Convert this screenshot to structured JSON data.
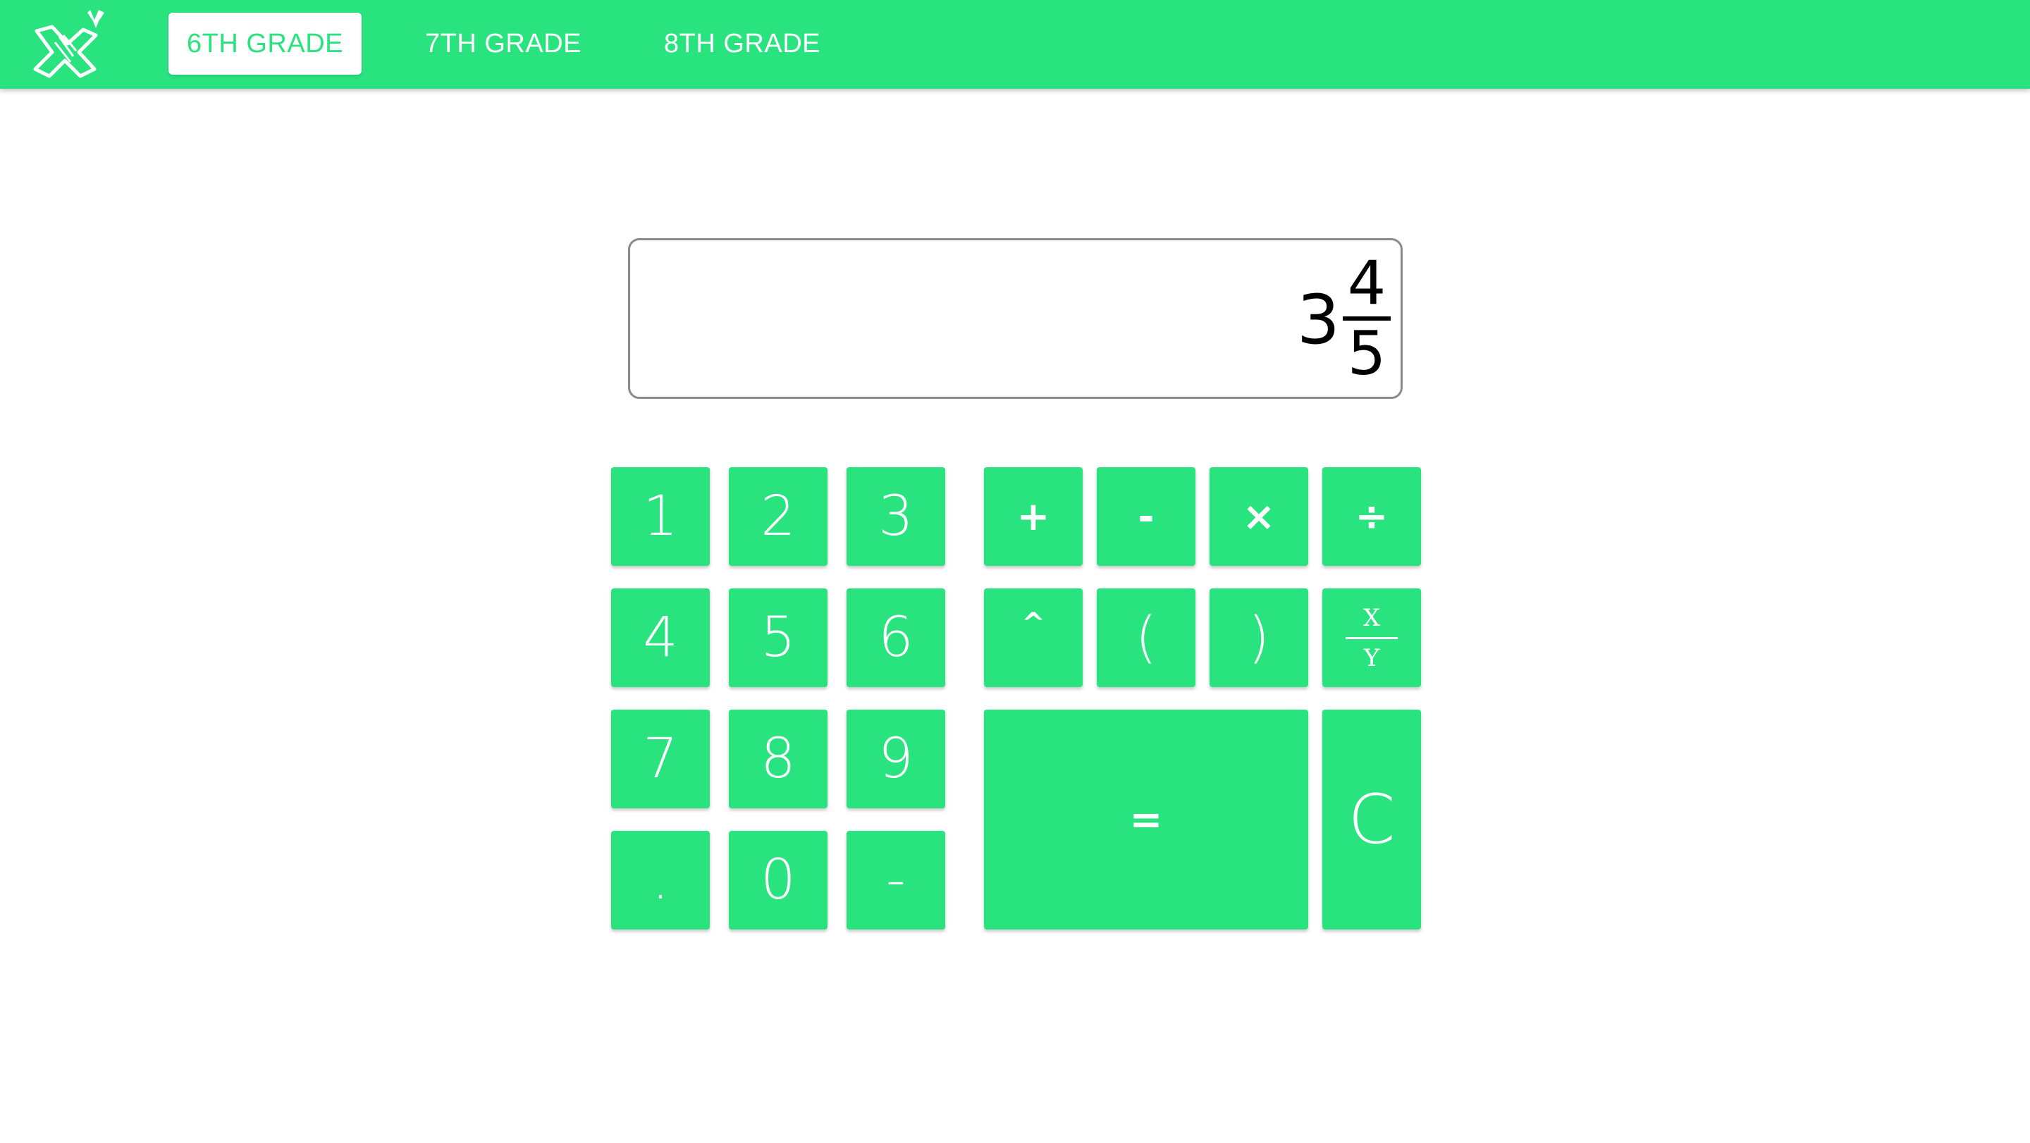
{
  "nav": {
    "logo": "math-x-logo",
    "tabs": [
      {
        "label": "6TH GRADE",
        "active": true
      },
      {
        "label": "7TH GRADE",
        "active": false
      },
      {
        "label": "8TH GRADE",
        "active": false
      }
    ]
  },
  "display": {
    "whole": "3",
    "numerator": "4",
    "denominator": "5"
  },
  "keypad": {
    "k1": "1",
    "k2": "2",
    "k3": "3",
    "k4": "4",
    "k5": "5",
    "k6": "6",
    "k7": "7",
    "k8": "8",
    "k9": "9",
    "dot": ".",
    "k0": "0",
    "neg": "-",
    "plus": "+",
    "minus": "-",
    "times": "×",
    "divide": "÷",
    "power": "^",
    "lparen": "(",
    "rparen": ")",
    "frac_top": "X",
    "frac_bottom": "Y",
    "equals": "=",
    "clear": "C"
  },
  "colors": {
    "accent": "#29e37f",
    "text": "#ffffff"
  }
}
